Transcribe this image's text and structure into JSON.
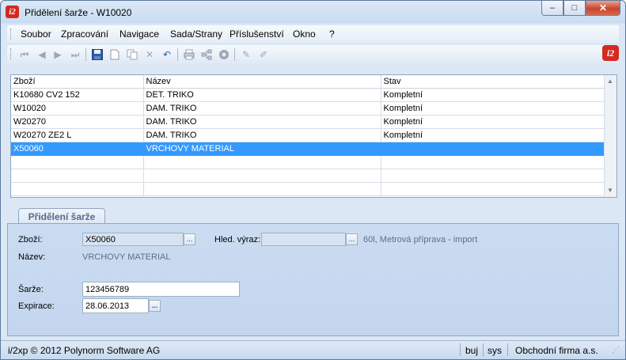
{
  "window": {
    "title": "Přidělení šarže - W10020",
    "logo_text": "i2",
    "controls": {
      "minimize": "–",
      "maximize": "□",
      "close": "✕"
    }
  },
  "menu": [
    "Soubor",
    "Zpracování",
    "Navigace",
    "Sada/Strany",
    "Příslušenství",
    "Okno",
    "?"
  ],
  "toolbar": {
    "icons": [
      "first-record-icon",
      "previous-record-icon",
      "next-record-icon",
      "last-record-icon",
      "save-icon",
      "new-document-icon",
      "copy-icon",
      "delete-icon",
      "undo-icon",
      "print-icon",
      "tree-icon",
      "settings-gear-icon",
      "edit-pen-icon",
      "edit-pen-alt-icon"
    ]
  },
  "grid": {
    "columns": [
      "Zboží",
      "Název",
      "Stav"
    ],
    "rows": [
      [
        "K10680 CV2 152",
        "DET. TRIKO",
        "Kompletní"
      ],
      [
        "W10020",
        "DAM. TRIKO",
        "Kompletní"
      ],
      [
        "W20270",
        "DAM. TRIKO",
        "Kompletní"
      ],
      [
        "W20270 ZE2 L",
        "DAM. TRIKO",
        "Kompletní"
      ],
      [
        "X50060",
        "VRCHOVY MATERIAL",
        ""
      ],
      [
        "",
        "",
        ""
      ],
      [
        "",
        "",
        ""
      ],
      [
        "",
        "",
        ""
      ]
    ],
    "selected_row": 4
  },
  "tab": {
    "label": "Přidělení šarže"
  },
  "form": {
    "zbozi_label": "Zboží:",
    "zbozi_value": "X50060",
    "hled_label": "Hled. výraz:",
    "hled_value": "",
    "info_text": "60l, Metrová příprava - import",
    "nazev_label": "Název:",
    "nazev_value": "VRCHOVY MATERIAL",
    "sarze_label": "Šarže:",
    "sarze_value": "123456789",
    "expirace_label": "Expirace:",
    "expirace_value": "28.06.2013",
    "dots": "..."
  },
  "status": {
    "copyright": "i/2xp © 2012 Polynorm Software AG",
    "user": "buj",
    "db": "sys",
    "company": "Obchodní firma a.s."
  },
  "colors": {
    "selection": "#3399ff",
    "logo": "#d32a1f"
  }
}
